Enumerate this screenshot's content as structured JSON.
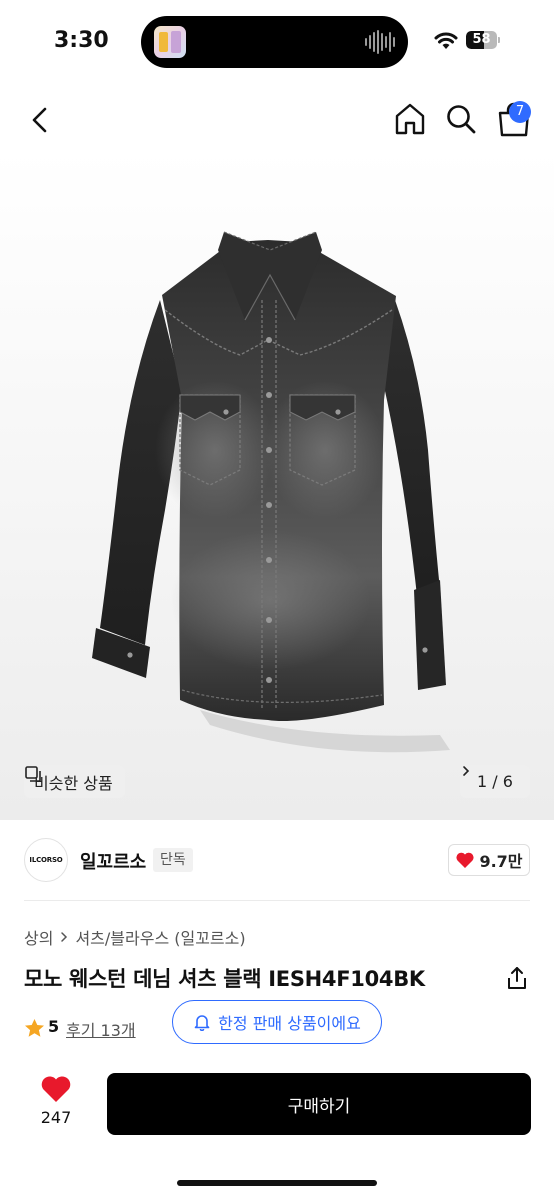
{
  "status_bar": {
    "time": "3:30",
    "battery_level": "58",
    "battery_fraction": 0.58,
    "icons": [
      "music-thumbnail-icon",
      "audio-wave-icon",
      "wifi-icon",
      "battery-icon"
    ]
  },
  "nav": {
    "icons": [
      "chevron-left-icon",
      "home-icon",
      "search-icon",
      "cart-icon"
    ],
    "cart_count": "7",
    "accent_color": "#2f6bff"
  },
  "gallery": {
    "similar_label": "비슷한 상품",
    "page_current": "1",
    "page_separator": "/",
    "page_total": "6"
  },
  "brand": {
    "logo_text": "ILCORSO",
    "name": "일꼬르소",
    "tag": "단독",
    "likes": "9.7만"
  },
  "product": {
    "category": "상의",
    "subcategory": "셔츠/블라우스 (일꼬르소)",
    "title": "모노 웨스턴 데님 셔츠 블랙 IESH4F104BK",
    "rating": "5",
    "reviews": "후기 13개",
    "limited_label": "한정 판매 상품이에요"
  },
  "bottom_bar": {
    "wish_count": "247",
    "buy_label": "구매하기",
    "heart_color": "#e8192c"
  }
}
